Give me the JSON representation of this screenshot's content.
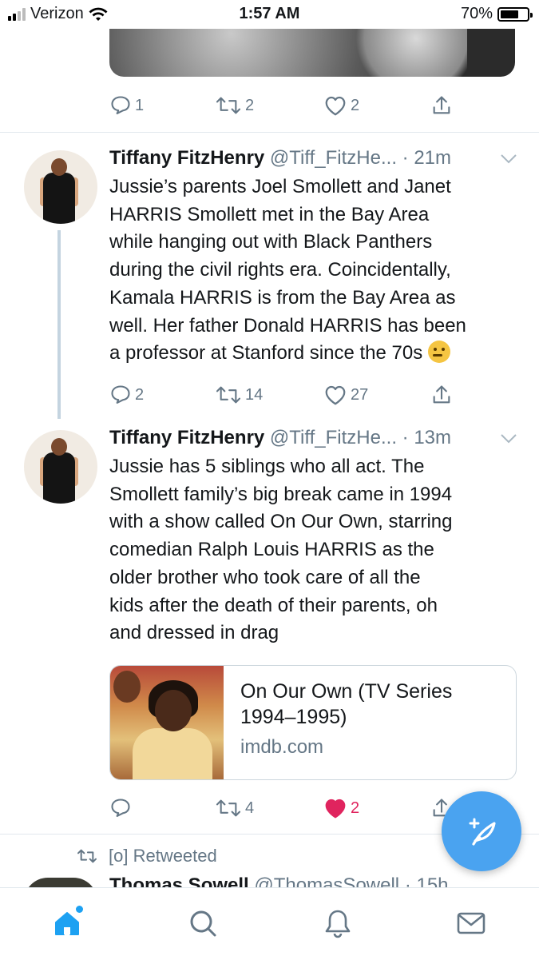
{
  "status_bar": {
    "carrier": "Verizon",
    "time": "1:57 AM",
    "battery": "70%",
    "battery_level": 0.7
  },
  "top_tweet": {
    "reply_count": "1",
    "retweet_count": "2",
    "like_count": "2"
  },
  "tweets": [
    {
      "author_name": "Tiffany FitzHenry",
      "handle": "@Tiff_FitzHe...",
      "time": "· 21m",
      "text_lines": [
        "Jussie’s parents Joel Smollett and Janet",
        "HARRIS Smollett met in the Bay Area",
        "while hanging out with Black Panthers",
        "during the civil rights era. Coincidentally,",
        "Kamala HARRIS is from the Bay Area as",
        "well. Her father Donald HARRIS has been",
        "a professor at Stanford since the 70s"
      ],
      "emoji": "thinking-face",
      "reply_count": "2",
      "retweet_count": "14",
      "like_count": "27"
    },
    {
      "author_name": "Tiffany FitzHenry",
      "handle": "@Tiff_FitzHe...",
      "time": "· 13m",
      "text_lines": [
        "Jussie has 5 siblings who all act. The",
        "Smollett family’s big break came in 1994",
        "with a show called On Our Own, starring",
        "comedian Ralph Louis HARRIS as the",
        "older brother who took care of all the",
        "kids after the death of their parents, oh",
        "and dressed in drag"
      ],
      "card": {
        "title_line1": "On Our Own (TV Series",
        "title_line2": "1994–1995)",
        "domain": "imdb.com"
      },
      "reply_count": "",
      "retweet_count": "4",
      "like_count": "2",
      "liked": true
    }
  ],
  "retweeted_label": "[o] Retweeted",
  "next_tweet": {
    "author_name": "Thomas Sowell",
    "handle": "@ThomasSowell",
    "time": "· 15h"
  },
  "colors": {
    "accent": "#1da1f2",
    "like": "#e0245e",
    "fab": "#4aa3f0",
    "muted": "#657786"
  },
  "tab_bar": [
    "home-icon",
    "search-icon",
    "notifications-icon",
    "messages-icon"
  ]
}
